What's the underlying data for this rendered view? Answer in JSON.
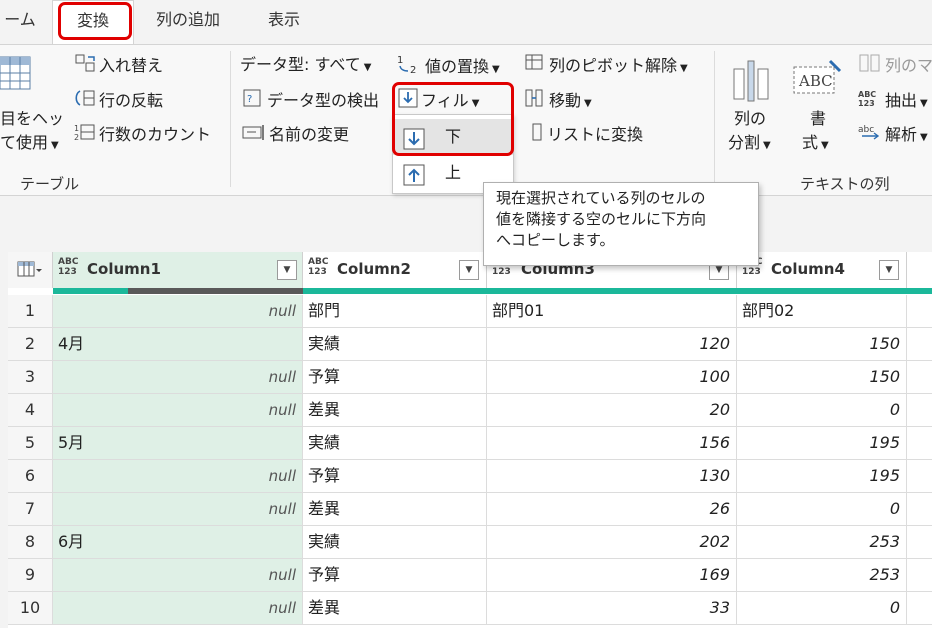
{
  "tabs": [
    {
      "label": "ーム"
    },
    {
      "label": "変換"
    },
    {
      "label": "列の追加"
    },
    {
      "label": "表示"
    }
  ],
  "ribbon": {
    "table_group": {
      "header_line1": "目をヘッ",
      "header_line2": "て使用",
      "transpose": "入れ替え",
      "reverse_rows": "行の反転",
      "count_rows": "行数のカウント",
      "group_label": "テーブル"
    },
    "anycol_group": {
      "data_type": "データ型: すべて",
      "detect_type": "データ型の検出",
      "rename": "名前の変更",
      "replace_values": "値の置換",
      "fill": "フィル",
      "unpivot": "列のピボット解除",
      "move": "移動",
      "to_list": "リストに変換"
    },
    "text_group": {
      "split_line1": "列の",
      "split_line2": "分割",
      "format_line1": "書",
      "format_line2": "式",
      "merge": "列のマ",
      "extract": "抽出",
      "parse": "解析",
      "group_label": "テキストの列"
    }
  },
  "fill_menu": {
    "down": "下",
    "up": "上"
  },
  "tooltip": {
    "line1": "現在選択されている列のセルの",
    "line2": "値を隣接する空のセルに下方向",
    "line3": "へコピーします。"
  },
  "grid": {
    "type_label_top": "ABC",
    "type_label_bottom": "123",
    "columns": [
      "Column1",
      "Column2",
      "Column3",
      "Column4"
    ],
    "rows": [
      {
        "n": "1",
        "c1": "null",
        "c2": "部門",
        "c3": "部門01",
        "c4": "部門02"
      },
      {
        "n": "2",
        "c1": "4月",
        "c2": "実績",
        "c3": "120",
        "c4": "150"
      },
      {
        "n": "3",
        "c1": "null",
        "c2": "予算",
        "c3": "100",
        "c4": "150"
      },
      {
        "n": "4",
        "c1": "null",
        "c2": "差異",
        "c3": "20",
        "c4": "0"
      },
      {
        "n": "5",
        "c1": "5月",
        "c2": "実績",
        "c3": "156",
        "c4": "195"
      },
      {
        "n": "6",
        "c1": "null",
        "c2": "予算",
        "c3": "130",
        "c4": "195"
      },
      {
        "n": "7",
        "c1": "null",
        "c2": "差異",
        "c3": "26",
        "c4": "0"
      },
      {
        "n": "8",
        "c1": "6月",
        "c2": "実績",
        "c3": "202",
        "c4": "253"
      },
      {
        "n": "9",
        "c1": "null",
        "c2": "予算",
        "c3": "169",
        "c4": "253"
      },
      {
        "n": "10",
        "c1": "null",
        "c2": "差異",
        "c3": "33",
        "c4": "0"
      }
    ]
  },
  "colors": {
    "highlight_red": "#e00000",
    "selected_column": "#dff0e6",
    "quality_bar": "#1bb89a",
    "icon_blue": "#2b6cb0"
  }
}
